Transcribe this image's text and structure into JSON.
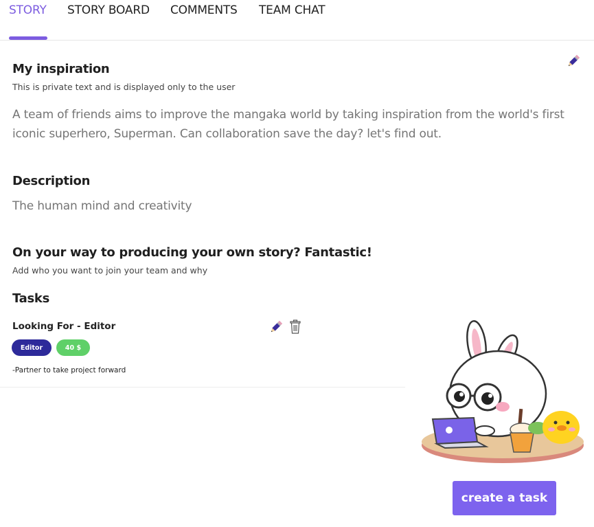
{
  "tabs": [
    {
      "label": "STORY",
      "active": true
    },
    {
      "label": "STORY BOARD",
      "active": false
    },
    {
      "label": "COMMENTS",
      "active": false
    },
    {
      "label": "TEAM CHAT",
      "active": false
    }
  ],
  "inspiration": {
    "title": "My inspiration",
    "subtitle": "This is private text and is displayed only to the user",
    "text": "A team of friends aims to improve the mangaka world by taking inspiration from the world's first iconic superhero, Superman. Can collaboration save the day? let's find out."
  },
  "description": {
    "title": "Description",
    "text": "The human mind and creativity"
  },
  "team": {
    "title": "On your way to producing your own story? Fantastic!",
    "subtitle": "Add who you want to join your team and why"
  },
  "tasks": {
    "title": "Tasks",
    "items": [
      {
        "title": "Looking For - Editor",
        "role": "Editor",
        "price": "40 $",
        "note": "-Partner to take project forward"
      }
    ]
  },
  "create_task_label": "create a task",
  "colors": {
    "accent": "#7c5ce0",
    "role_badge": "#2d2a9a",
    "price_badge": "#5fd068",
    "button": "#7d63ee"
  },
  "icons": [
    "pencil-icon",
    "trash-icon"
  ],
  "illustration": "bunny-with-laptop-and-chick"
}
